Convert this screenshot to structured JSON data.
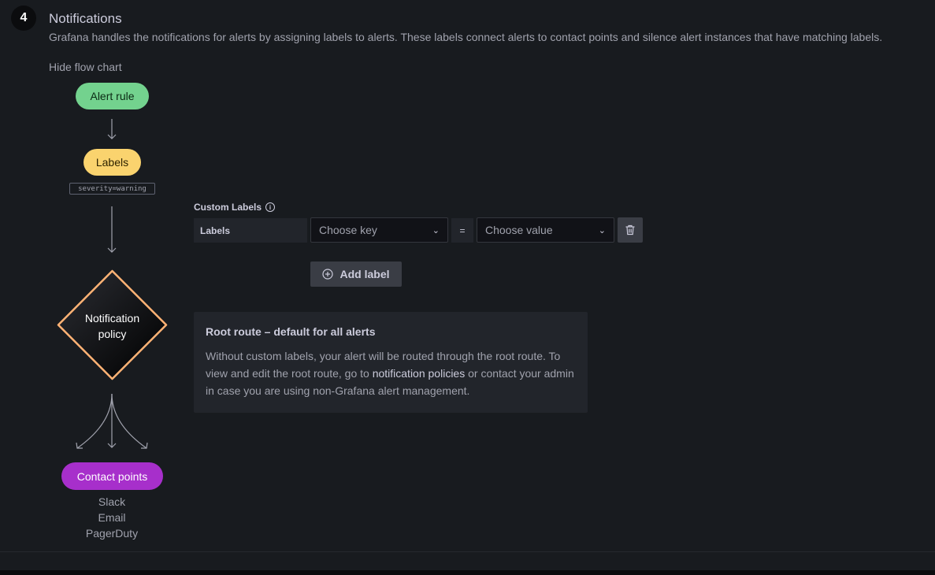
{
  "section": {
    "step": "4",
    "title": "Notifications",
    "description": "Grafana handles the notifications for alerts by assigning labels to alerts. These labels connect alerts to contact points and silence alert instances that have matching labels.",
    "hide_flow_chart": "Hide flow chart"
  },
  "flowchart": {
    "alert_rule": "Alert rule",
    "labels": "Labels",
    "label_example": "severity=warning",
    "policy_line1": "Notification",
    "policy_line2": "policy",
    "contact_points": "Contact points",
    "contacts": [
      "Slack",
      "Email",
      "PagerDuty"
    ],
    "colors": {
      "alert_rule": "#73d28e",
      "labels": "#fad36e",
      "policy_border": "#ffb375",
      "contact_points": "#a72fcb"
    }
  },
  "custom_labels": {
    "title": "Custom Labels",
    "row_label": "Labels",
    "key_placeholder": "Choose key",
    "operator": "=",
    "value_placeholder": "Choose value",
    "add_label": "Add label"
  },
  "info_box": {
    "title": "Root route – default for all alerts",
    "body_before": "Without custom labels, your alert will be routed through the root route. To view and edit the root route, go to ",
    "link": "notification policies",
    "body_after": " or contact your admin in case you are using non-Grafana alert management."
  }
}
